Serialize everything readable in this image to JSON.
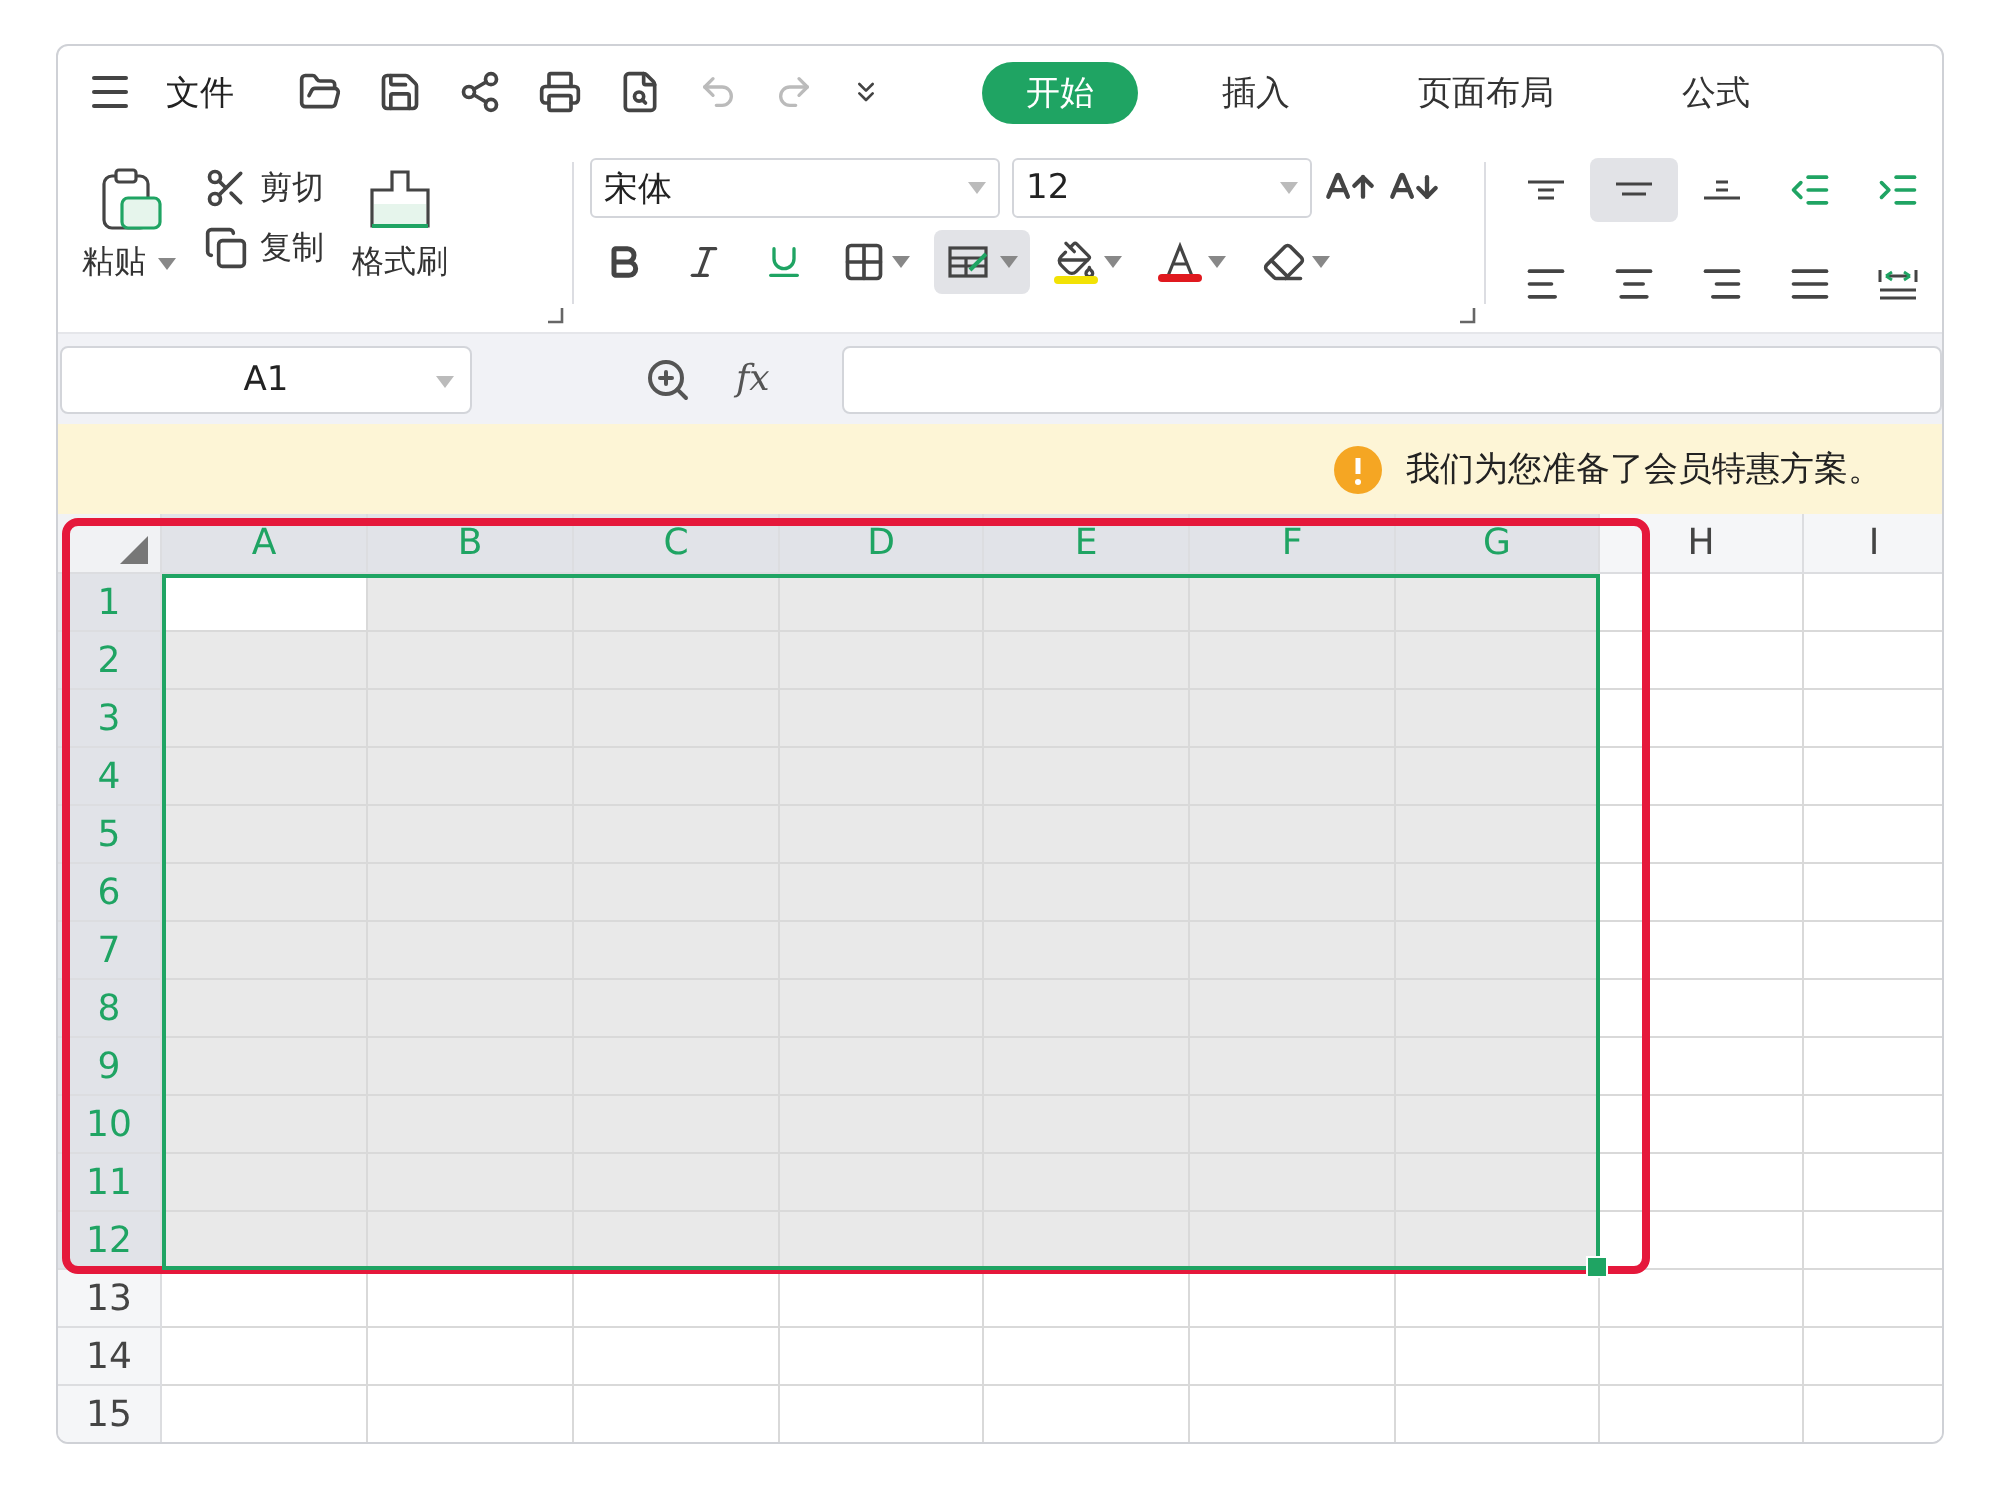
{
  "menu": {
    "label": "文件"
  },
  "tabs": [
    {
      "label": "开始",
      "selected": true
    },
    {
      "label": "插入",
      "selected": false
    },
    {
      "label": "页面布局",
      "selected": false
    },
    {
      "label": "公式",
      "selected": false
    }
  ],
  "clipboard": {
    "paste": "粘贴",
    "cut": "剪切",
    "copy": "复制",
    "format_painter": "格式刷"
  },
  "font": {
    "name": "宋体",
    "size": "12"
  },
  "font_tools": [
    {
      "kind": "bold",
      "selected": false
    },
    {
      "kind": "italic",
      "selected": false
    },
    {
      "kind": "underline",
      "selected": false
    },
    {
      "kind": "borders",
      "selected": false
    },
    {
      "kind": "cell-style",
      "selected": true
    },
    {
      "kind": "fill",
      "selected": false,
      "color": "#f2e205"
    },
    {
      "kind": "font-color",
      "selected": false,
      "color": "#e0191f"
    },
    {
      "kind": "clear",
      "selected": false
    }
  ],
  "align_tools": [
    {
      "kind": "top",
      "selected": false
    },
    {
      "kind": "middle",
      "selected": true
    },
    {
      "kind": "bottom",
      "selected": false
    },
    {
      "kind": "outdent",
      "selected": false
    },
    {
      "kind": "indent",
      "selected": false
    },
    {
      "kind": "left",
      "selected": false
    },
    {
      "kind": "center",
      "selected": false
    },
    {
      "kind": "right",
      "selected": false
    },
    {
      "kind": "justify",
      "selected": false
    },
    {
      "kind": "distribute",
      "selected": false
    }
  ],
  "formula_bar": {
    "name_box": "A1",
    "fx": "fx"
  },
  "notice": {
    "text": "我们为您准备了会员特惠方案。"
  },
  "columns": [
    {
      "label": "A",
      "selected": true
    },
    {
      "label": "B",
      "selected": true
    },
    {
      "label": "C",
      "selected": true
    },
    {
      "label": "D",
      "selected": true
    },
    {
      "label": "E",
      "selected": true
    },
    {
      "label": "F",
      "selected": true
    },
    {
      "label": "G",
      "selected": true
    },
    {
      "label": "H",
      "selected": false
    },
    {
      "label": "I",
      "selected": false
    }
  ],
  "rows": [
    {
      "label": "1",
      "selected": true
    },
    {
      "label": "2",
      "selected": true
    },
    {
      "label": "3",
      "selected": true
    },
    {
      "label": "4",
      "selected": true
    },
    {
      "label": "5",
      "selected": true
    },
    {
      "label": "6",
      "selected": true
    },
    {
      "label": "7",
      "selected": true
    },
    {
      "label": "8",
      "selected": true
    },
    {
      "label": "9",
      "selected": true
    },
    {
      "label": "10",
      "selected": true
    },
    {
      "label": "11",
      "selected": true
    },
    {
      "label": "12",
      "selected": true
    },
    {
      "label": "13",
      "selected": false
    },
    {
      "label": "14",
      "selected": false
    },
    {
      "label": "15",
      "selected": false
    }
  ],
  "highlight_frame": true
}
